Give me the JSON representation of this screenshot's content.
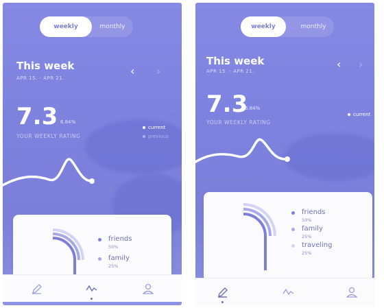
{
  "left": {
    "tabs": {
      "active": "weekly",
      "inactive": "monthly"
    },
    "title": "This week",
    "range": "APR 15. - APR 21.",
    "rating": {
      "value": "7.3",
      "delta": "6.84%",
      "label": "YOUR WEEKLY RATING"
    },
    "legend": {
      "current": "current",
      "previous": "previous"
    },
    "categories": [
      {
        "name": "friends",
        "pct": "50%"
      },
      {
        "name": "family",
        "pct": "25%"
      }
    ]
  },
  "right": {
    "tabs": {
      "active": "weekly",
      "inactive": "monthly"
    },
    "title": "This week",
    "range": "APR 15. - APR 21.",
    "rating": {
      "value": "7.3",
      "delta": "6.84%",
      "label": "YOUR WEEKLY RATING"
    },
    "legend": {
      "current": "current"
    },
    "categories": [
      {
        "name": "friends",
        "pct": "50%"
      },
      {
        "name": "family",
        "pct": "25%"
      },
      {
        "name": "traveling",
        "pct": "25%"
      }
    ]
  },
  "colors": {
    "accent": "#7b7fd9",
    "card": "#fbfbfe",
    "text": "#6f70b5",
    "friends": "#7b7fd9",
    "family": "#a6a8e8",
    "traveling": "#d3d4f3"
  },
  "icons": {
    "nav": [
      "pencil-icon",
      "activity-icon",
      "user-icon"
    ]
  }
}
